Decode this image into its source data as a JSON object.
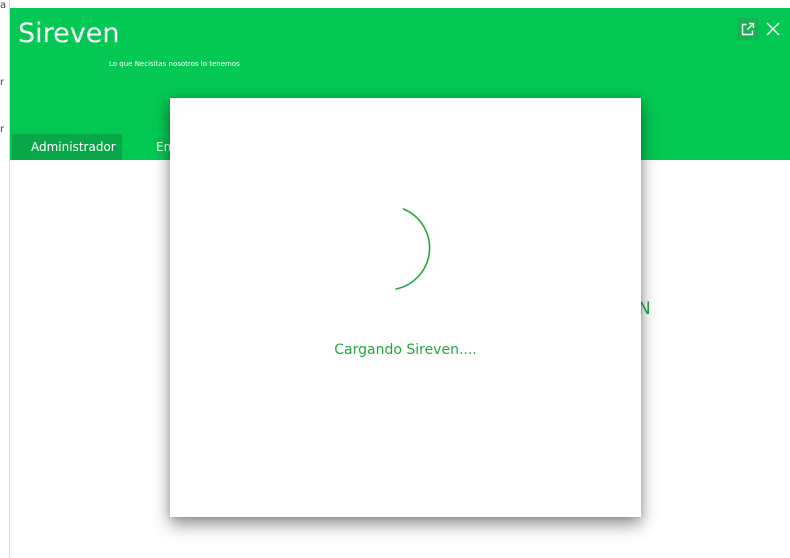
{
  "app": {
    "title": "Sireven",
    "tagline": "Lo que Necisitas nosotros lo tenemos"
  },
  "window_controls": [
    {
      "icon": "external-link-icon"
    },
    {
      "icon": "close-icon"
    }
  ],
  "tabs": [
    {
      "label": "Administrador",
      "active": true
    },
    {
      "label": "Em",
      "active": false
    }
  ],
  "background": {
    "partial_text": "N"
  },
  "left_edge": {
    "glyphs": [
      "a",
      "r",
      "r"
    ]
  },
  "loading": {
    "message": "Cargando Sireven...."
  },
  "colors": {
    "header": "#03c853",
    "tab_active": "#08a848",
    "accent_text": "#23a840",
    "spinner": "#23a840"
  }
}
